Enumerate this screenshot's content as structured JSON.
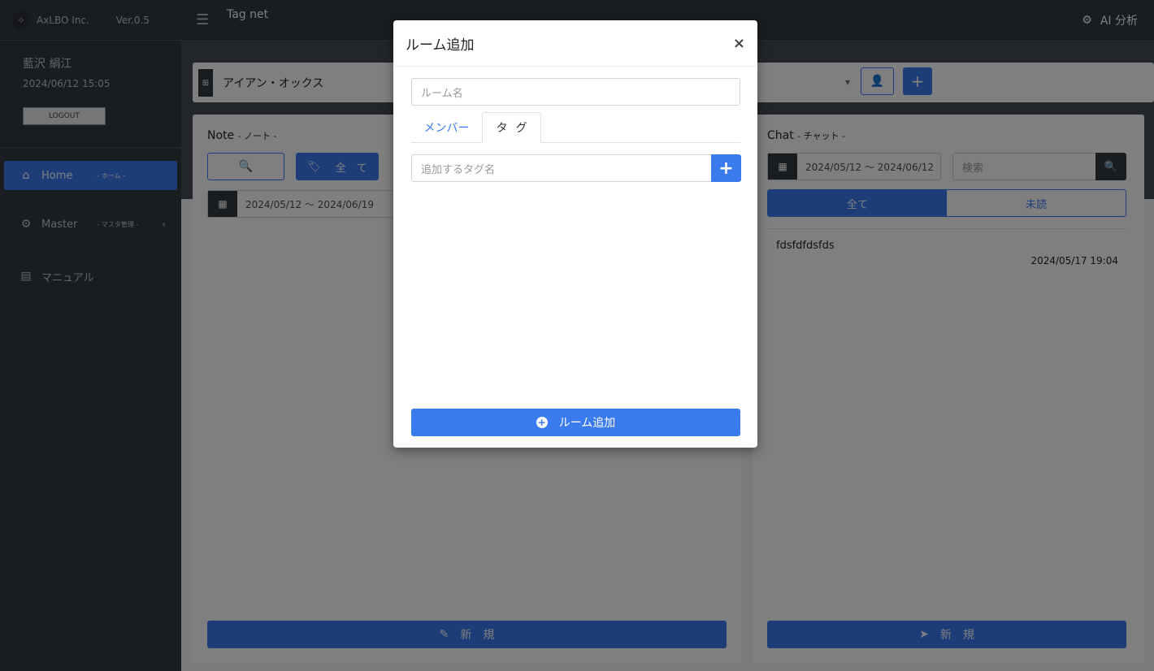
{
  "brand": {
    "name": "AxLBO Inc.",
    "version": "Ver.0.5"
  },
  "user": {
    "name": "藍沢 絹江",
    "datetime": "2024/06/12 15:05",
    "logout_label": "LOGOUT"
  },
  "sidebar": {
    "items": [
      {
        "label": "Home",
        "sub": "- ホーム -"
      },
      {
        "label": "Master",
        "sub": "- マスタ管理 -"
      },
      {
        "label": "マニュアル",
        "sub": ""
      }
    ]
  },
  "topbar": {
    "title": "Tag net",
    "ai_label": "AI 分析"
  },
  "room_select": {
    "value": "アイアン・オックス"
  },
  "note": {
    "title": "Note",
    "subtitle": "- ノート -",
    "all_label": "全　て",
    "date_range": "2024/05/12 〜 2024/06/19",
    "new_label": "新　規"
  },
  "chat": {
    "title": "Chat",
    "subtitle": "- チャット -",
    "date_range": "2024/05/12 〜 2024/06/12",
    "search_placeholder": "検索",
    "tab_all": "全て",
    "tab_unread": "未読",
    "messages": [
      {
        "text": "fdsfdfdsfds",
        "time": "2024/05/17 19:04"
      }
    ],
    "new_label": "新　規"
  },
  "modal": {
    "title": "ルーム追加",
    "close": "×",
    "room_name_placeholder": "ルーム名",
    "tabs": {
      "members": "メンバー",
      "tag": "タグ"
    },
    "tag_placeholder": "追加するタグ名",
    "submit_label": "ルーム追加"
  },
  "colors": {
    "primary": "#3a7bf0",
    "sidebar": "#343a40"
  }
}
